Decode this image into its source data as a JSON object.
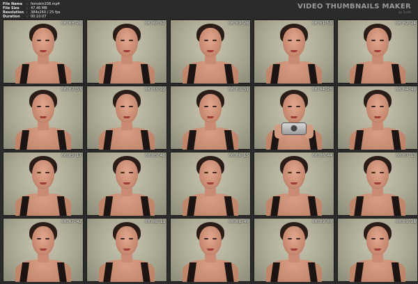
{
  "meta": {
    "rows": [
      {
        "key": "File Name",
        "value": "femdstr208.mp4"
      },
      {
        "key": "File Size",
        "value": "47.46 MB"
      },
      {
        "key": "Resolution",
        "value": "384x240 / 25 fps"
      },
      {
        "key": "Duration",
        "value": "00:10:07"
      }
    ],
    "separator": ":"
  },
  "brand": {
    "title": "VIDEO THUMBNAILS MAKER",
    "subtitle": "by Scatti"
  },
  "thumbnails": [
    {
      "time": "00:00:28"
    },
    {
      "time": "00:00:57"
    },
    {
      "time": "00:01:26"
    },
    {
      "time": "00:01:55"
    },
    {
      "time": "00:02:24"
    },
    {
      "time": "00:02:53"
    },
    {
      "time": "00:03:22"
    },
    {
      "time": "00:03:51"
    },
    {
      "time": "00:04:20",
      "camera": true
    },
    {
      "time": "00:04:49"
    },
    {
      "time": "00:05:17"
    },
    {
      "time": "00:05:46"
    },
    {
      "time": "00:06:15"
    },
    {
      "time": "00:06:44"
    },
    {
      "time": "00:07:13"
    },
    {
      "time": "00:07:42"
    },
    {
      "time": "00:08:11"
    },
    {
      "time": "00:08:40"
    },
    {
      "time": "00:09:09"
    },
    {
      "time": "00:09:38"
    }
  ]
}
